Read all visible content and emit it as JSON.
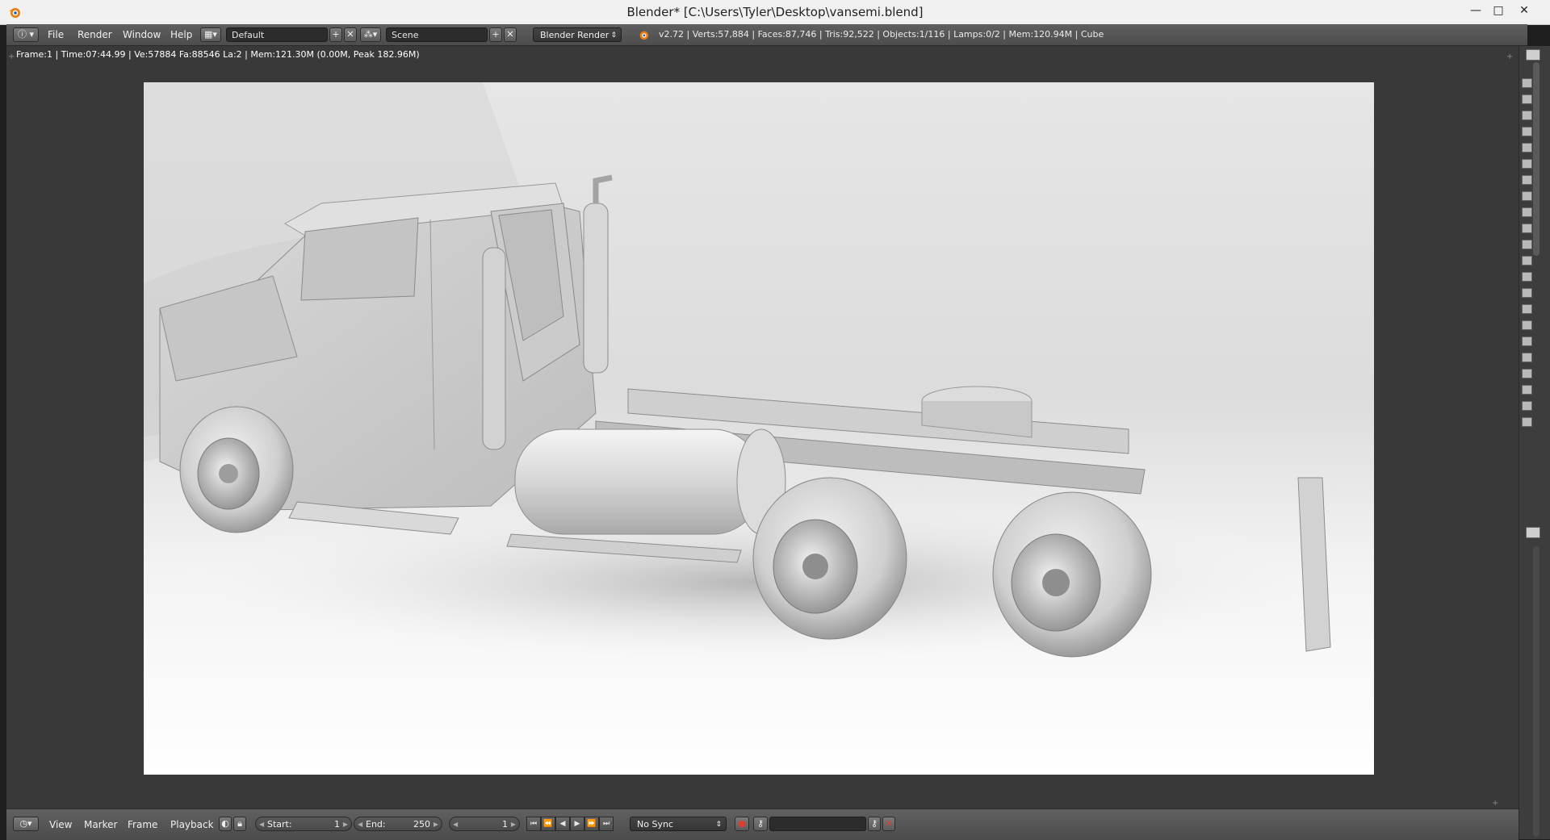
{
  "window": {
    "title": "Blender* [C:\\Users\\Tyler\\Desktop\\vansemi.blend]",
    "minimize_glyph": "—",
    "maximize_glyph": "□",
    "close_glyph": "✕"
  },
  "info_header": {
    "menus": [
      "File",
      "Render",
      "Window",
      "Help"
    ],
    "layout": "Default",
    "scene": "Scene",
    "render_engine": "Blender Render",
    "stats": "v2.72 | Verts:57,884 | Faces:87,746 | Tris:92,522 | Objects:1/116 | Lamps:0/2 | Mem:120.94M | Cube"
  },
  "image_editor": {
    "render_info": "Frame:1 | Time:07:44.99 | Ve:57884 Fa:88546 La:2 | Mem:121.30M (0.00M, Peak 182.96M)"
  },
  "timeline": {
    "menus": [
      "View",
      "Marker",
      "Frame",
      "Playback"
    ],
    "start_label": "Start:",
    "start_value": "1",
    "end_label": "End:",
    "end_value": "250",
    "current_frame": "1",
    "sync_mode": "No Sync"
  },
  "icons": {
    "app": "blender-logo-icon",
    "editor_type": "info-editor-icon",
    "timeline_editor": "timeline-editor-icon",
    "record": "record-icon",
    "keying": "key-icon"
  },
  "colors": {
    "accent_orange": "#e87d0d",
    "header_gray": "#555555",
    "editor_bg": "#393939"
  }
}
